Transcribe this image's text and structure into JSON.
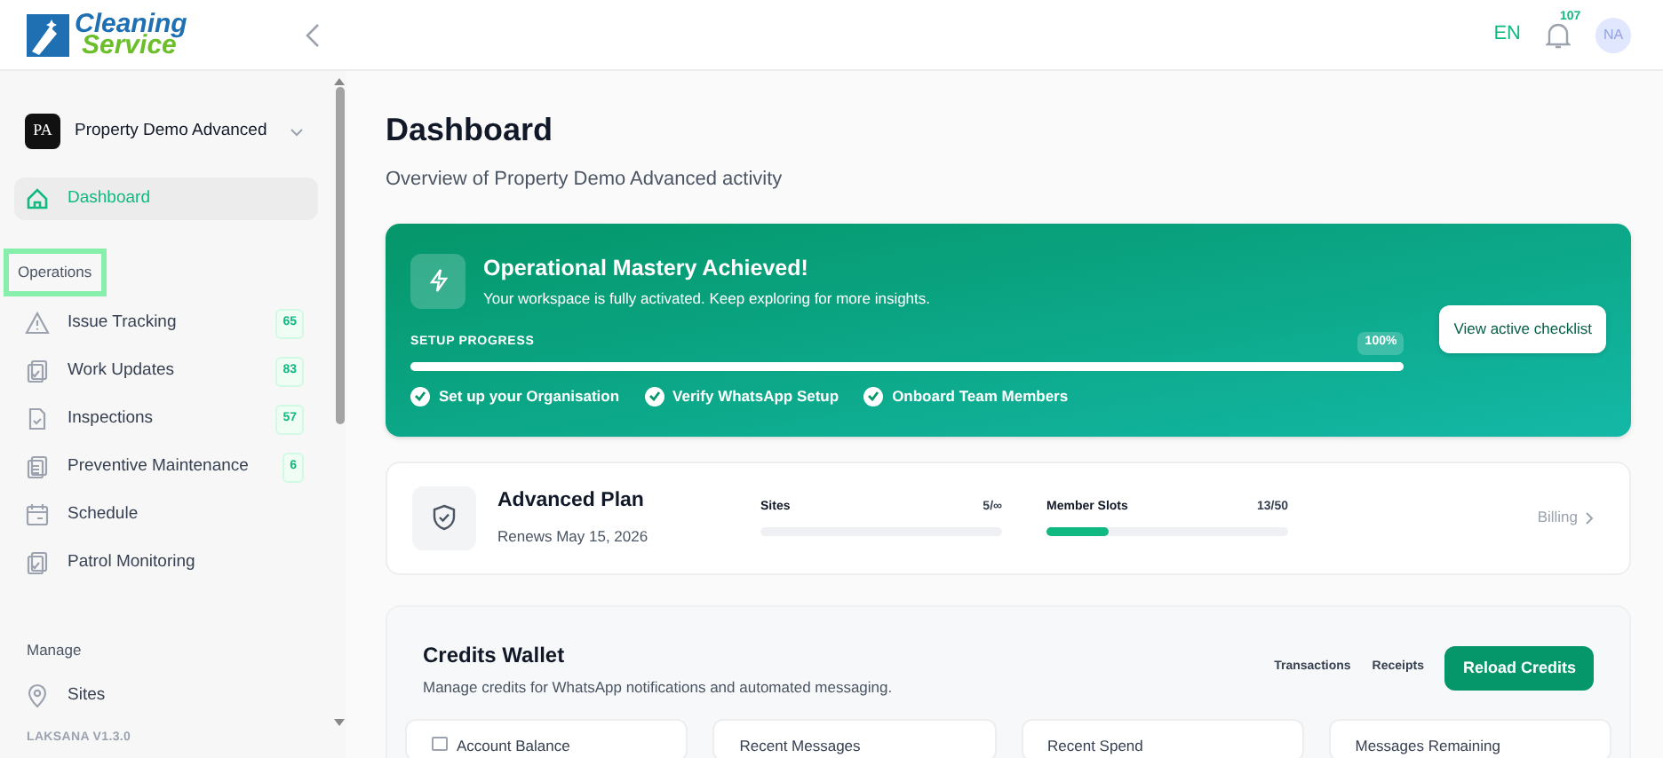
{
  "header": {
    "logo_line_1": "Cleaning",
    "logo_line_2": "Service",
    "language": "EN",
    "notification_count": "107",
    "avatar": "NA"
  },
  "sidebar": {
    "org": {
      "initials": "PA",
      "name": "Property Demo Advanced"
    },
    "top_items": [
      {
        "label": "Dashboard",
        "kind": "home",
        "selected": true
      }
    ],
    "sections": [
      {
        "title": "Operations",
        "highlighted": true,
        "items": [
          {
            "label": "Issue Tracking",
            "kind": "warning",
            "badge": "65",
            "selected": false
          },
          {
            "label": "Work Updates",
            "kind": "copy",
            "badge": "83",
            "selected": false
          },
          {
            "label": "Inspections",
            "kind": "file",
            "badge": "57",
            "selected": false
          },
          {
            "label": "Preventive Maintenance",
            "kind": "clipboard",
            "badge": "6",
            "selected": false
          },
          {
            "label": "Schedule",
            "kind": "calendar",
            "selected": false
          },
          {
            "label": "Patrol Monitoring",
            "kind": "copy",
            "selected": false
          }
        ]
      },
      {
        "title": "Manage",
        "highlighted": false,
        "items": [
          {
            "label": "Sites",
            "kind": "pin",
            "selected": false
          }
        ]
      }
    ],
    "version": "LAKSANA V1.3.0"
  },
  "page": {
    "title": "Dashboard",
    "subtitle": "Overview of Property Demo Advanced activity"
  },
  "banner": {
    "title": "Operational Mastery Achieved!",
    "subtitle": "Your workspace is fully activated. Keep exploring for more insights.",
    "progress_label": "SETUP PROGRESS",
    "progress_reading": "100%",
    "level": 1,
    "steps": [
      {
        "label": "Set up your Organisation",
        "checked": true
      },
      {
        "label": "Verify WhatsApp Setup",
        "checked": true
      },
      {
        "label": "Onboard Team Members",
        "checked": true
      }
    ],
    "button": "View active checklist"
  },
  "plan": {
    "name": "Advanced Plan",
    "renews": "Renews May 15, 2026",
    "meters": [
      {
        "label": "Sites",
        "reading": "5/∞",
        "level": 0
      },
      {
        "label": "Member Slots",
        "reading": "13/50",
        "level": 0.26
      }
    ],
    "billing": "Billing"
  },
  "wallet": {
    "title": "Credits Wallet",
    "subtitle": "Manage credits for WhatsApp notifications and automated messaging.",
    "links": [
      "Transactions",
      "Receipts"
    ],
    "button": "Reload Credits",
    "cards": [
      {
        "label": "Account Balance",
        "icon": true
      },
      {
        "label": "Recent Messages",
        "icon": false
      },
      {
        "label": "Recent Spend",
        "icon": false
      },
      {
        "label": "Messages Remaining",
        "icon": false
      }
    ]
  }
}
